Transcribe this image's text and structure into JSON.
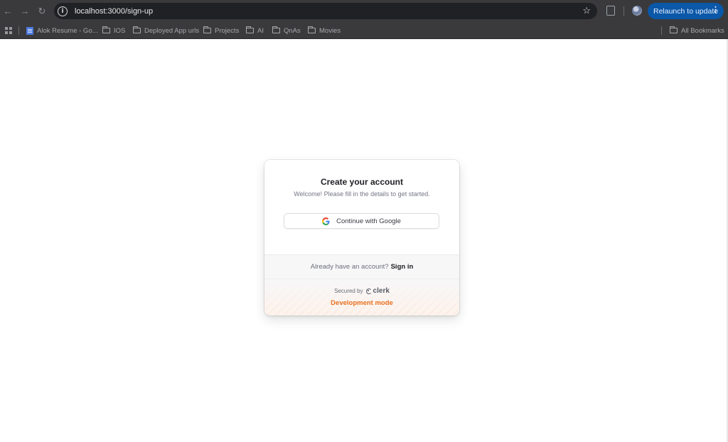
{
  "browser": {
    "url": "localhost:3000/sign-up",
    "relaunch_label": "Relaunch to update",
    "bookmarks": [
      {
        "label": "Alok Resume - Go...",
        "icon": "google-docs-icon"
      },
      {
        "label": "IOS",
        "icon": "folder-icon"
      },
      {
        "label": "Deployed App urls",
        "icon": "folder-icon"
      },
      {
        "label": "Projects",
        "icon": "folder-icon"
      },
      {
        "label": "AI",
        "icon": "folder-icon"
      },
      {
        "label": "QnAs",
        "icon": "folder-icon"
      },
      {
        "label": "Movies",
        "icon": "folder-icon"
      }
    ],
    "all_bookmarks_label": "All Bookmarks",
    "colors": {
      "toolbar": "#3a3a3c",
      "omnibox": "#202124",
      "relaunch": "#0b57a8"
    }
  },
  "signup": {
    "title": "Create your account",
    "subtitle": "Welcome! Please fill in the details to get started.",
    "google_button": "Continue with Google",
    "signin_prompt": "Already have an account?",
    "signin_link": "Sign in",
    "secured_by": "Secured by",
    "clerk_brand": "clerk",
    "dev_mode": "Development mode",
    "colors": {
      "dev_mode": "#e8701f",
      "title": "#212126"
    }
  }
}
